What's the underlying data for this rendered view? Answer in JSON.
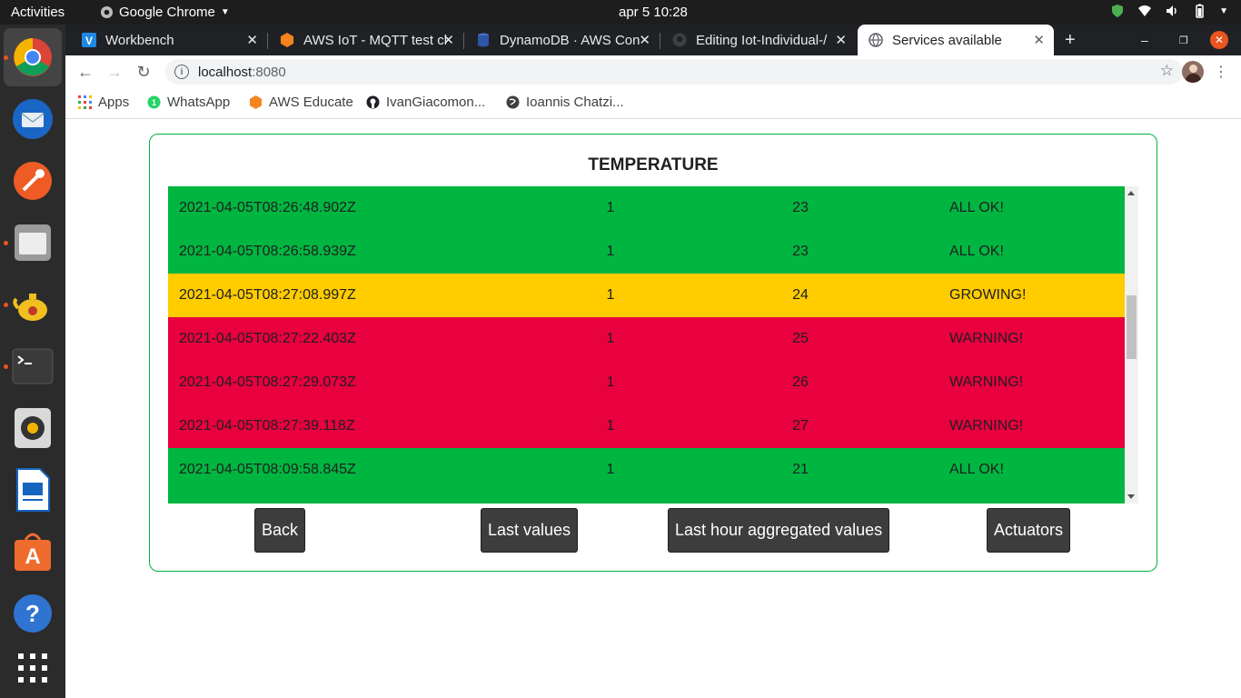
{
  "topbar": {
    "activities": "Activities",
    "app_name": "Google Chrome",
    "clock": "apr 5  10:28"
  },
  "tabs": [
    {
      "title": "Workbench",
      "icon": "workbench-icon",
      "active": false
    },
    {
      "title": "AWS IoT - MQTT test cl",
      "icon": "aws-iot-icon",
      "active": false
    },
    {
      "title": "DynamoDB · AWS Con",
      "icon": "dynamodb-icon",
      "active": false
    },
    {
      "title": "Editing Iot-Individual-/",
      "icon": "github-icon",
      "active": false
    },
    {
      "title": "Services available",
      "icon": "globe-icon",
      "active": true
    }
  ],
  "address": {
    "host": "localhost",
    "port": ":8080"
  },
  "bookmarks": [
    {
      "label": "Apps",
      "icon": "apps-grid-icon"
    },
    {
      "label": "WhatsApp",
      "icon": "whatsapp-icon"
    },
    {
      "label": "AWS Educate",
      "icon": "aws-educate-icon"
    },
    {
      "label": "IvanGiacomon...",
      "icon": "github-icon"
    },
    {
      "label": "Ioannis Chatzi...",
      "icon": "globe-icon"
    }
  ],
  "panel": {
    "title": "TEMPERATURE",
    "rows": [
      {
        "timestamp": "2021-04-05T08:26:48.902Z",
        "id": "1",
        "value": "23",
        "status": "ALL OK!",
        "level": "ok"
      },
      {
        "timestamp": "2021-04-05T08:26:58.939Z",
        "id": "1",
        "value": "23",
        "status": "ALL OK!",
        "level": "ok"
      },
      {
        "timestamp": "2021-04-05T08:27:08.997Z",
        "id": "1",
        "value": "24",
        "status": "GROWING!",
        "level": "grow"
      },
      {
        "timestamp": "2021-04-05T08:27:22.403Z",
        "id": "1",
        "value": "25",
        "status": "WARNING!",
        "level": "warn"
      },
      {
        "timestamp": "2021-04-05T08:27:29.073Z",
        "id": "1",
        "value": "26",
        "status": "WARNING!",
        "level": "warn"
      },
      {
        "timestamp": "2021-04-05T08:27:39.118Z",
        "id": "1",
        "value": "27",
        "status": "WARNING!",
        "level": "warn"
      },
      {
        "timestamp": "2021-04-05T08:09:58.845Z",
        "id": "1",
        "value": "21",
        "status": "ALL OK!",
        "level": "ok"
      },
      {
        "timestamp": "",
        "id": "",
        "value": "",
        "status": "",
        "level": "ok"
      }
    ],
    "buttons": {
      "back": "Back",
      "last_values": "Last values",
      "aggregated": "Last hour aggregated values",
      "actuators": "Actuators"
    }
  },
  "colors": {
    "ok": "#00b640",
    "growing": "#ffcc00",
    "warning": "#e8003f",
    "panel_border": "#00b140"
  }
}
